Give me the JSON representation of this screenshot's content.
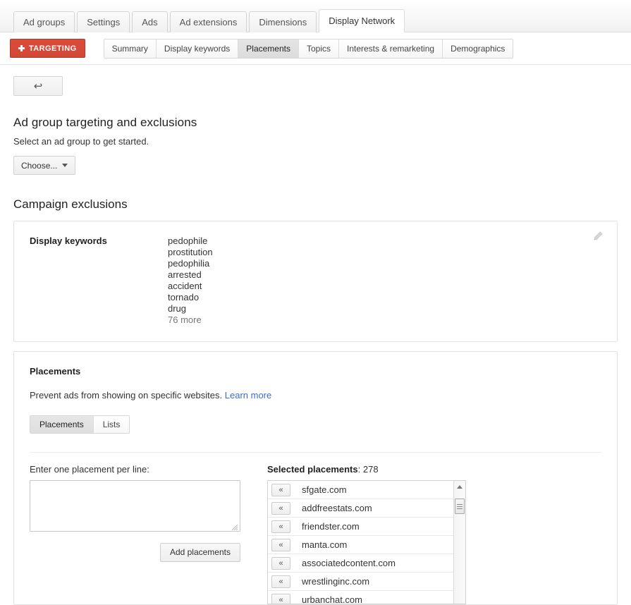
{
  "main_tabs": [
    {
      "label": "Ad groups",
      "active": false
    },
    {
      "label": "Settings",
      "active": false
    },
    {
      "label": "Ads",
      "active": false
    },
    {
      "label": "Ad extensions",
      "active": false
    },
    {
      "label": "Dimensions",
      "active": false
    },
    {
      "label": "Display Network",
      "active": true
    }
  ],
  "toolbar": {
    "targeting_label": "+ TARGETING",
    "targeting_text": "TARGETING",
    "targeting_color": "#d14836"
  },
  "sub_tabs": [
    {
      "label": "Summary",
      "active": false
    },
    {
      "label": "Display keywords",
      "active": false
    },
    {
      "label": "Placements",
      "active": true
    },
    {
      "label": "Topics",
      "active": false
    },
    {
      "label": "Interests & remarketing",
      "active": false
    },
    {
      "label": "Demographics",
      "active": false
    }
  ],
  "back_button": {
    "glyph": "↩"
  },
  "targeting_section": {
    "title": "Ad group targeting and exclusions",
    "subtitle": "Select an ad group to get started.",
    "choose_label": "Choose..."
  },
  "campaign_exclusions": {
    "title": "Campaign exclusions",
    "display_keywords": {
      "label": "Display keywords",
      "values": [
        "pedophile",
        "prostitution",
        "pedophilia",
        "arrested",
        "accident",
        "tornado",
        "drug"
      ],
      "more": "76 more"
    }
  },
  "placements_card": {
    "title": "Placements",
    "description": "Prevent ads from showing on specific websites.",
    "learn_more": "Learn more",
    "segments": [
      {
        "label": "Placements",
        "active": true
      },
      {
        "label": "Lists",
        "active": false
      }
    ],
    "input_label": "Enter one placement per line:",
    "input_value": "",
    "input_placeholder": "",
    "add_button": "Add placements",
    "selected_label": "Selected placements",
    "selected_count": "278",
    "remove_glyph": "«",
    "selected_items": [
      "sfgate.com",
      "addfreestats.com",
      "friendster.com",
      "manta.com",
      "associatedcontent.com",
      "wrestlinginc.com",
      "urbanchat.com"
    ]
  },
  "link_color": "#3b6dc4"
}
